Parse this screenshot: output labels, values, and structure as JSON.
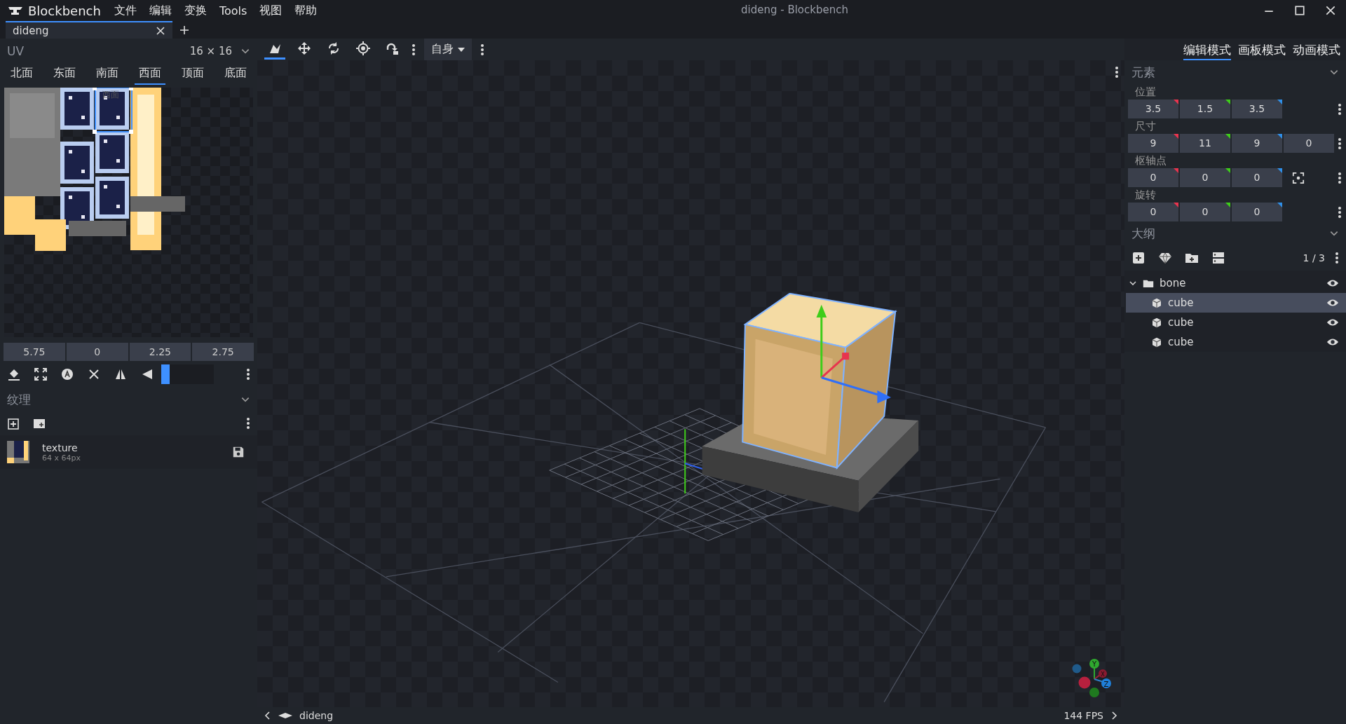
{
  "app": {
    "name": "Blockbench"
  },
  "menu": [
    "文件",
    "编辑",
    "变换",
    "Tools",
    "视图",
    "帮助"
  ],
  "window": {
    "title": "dideng - Blockbench"
  },
  "tabs": [
    {
      "label": "dideng",
      "selected": true
    }
  ],
  "uv_panel": {
    "title": "UV",
    "size": "16 × 16",
    "faces": [
      {
        "label": "北面",
        "selected": false
      },
      {
        "label": "东面",
        "selected": false
      },
      {
        "label": "南面",
        "selected": false
      },
      {
        "label": "西面",
        "selected": true
      },
      {
        "label": "顶面",
        "selected": false
      },
      {
        "label": "底面",
        "selected": false
      }
    ],
    "face_label": "西面",
    "fields": [
      "5.75",
      "0",
      "2.25",
      "2.75"
    ],
    "slider": {
      "level": 0.16
    }
  },
  "textures_panel": {
    "title": "纹理",
    "items": [
      {
        "name": "texture",
        "size": "64 x 64px"
      }
    ]
  },
  "toolbar": {
    "tools": [
      {
        "kind": "vertex",
        "selected": true
      },
      {
        "kind": "move",
        "selected": false
      },
      {
        "kind": "rotate",
        "selected": false
      },
      {
        "kind": "pivot",
        "selected": false
      },
      {
        "kind": "resize",
        "selected": false
      }
    ],
    "space": "自身"
  },
  "modes": [
    {
      "label": "编辑模式",
      "selected": true
    },
    {
      "label": "画板模式",
      "selected": false
    },
    {
      "label": "动画模式",
      "selected": false
    }
  ],
  "element_panel": {
    "title": "元素",
    "groups": [
      {
        "label": "位置",
        "kind": "vector",
        "values": [
          "3.5",
          "1.5",
          "3.5"
        ]
      },
      {
        "label": "尺寸",
        "kind": "vector",
        "values": [
          "9",
          "11",
          "9",
          "0"
        ]
      },
      {
        "label": "枢轴点",
        "kind": "pivot",
        "values": [
          "0",
          "0",
          "0"
        ]
      },
      {
        "label": "旋转",
        "kind": "vector",
        "values": [
          "0",
          "0",
          "0"
        ]
      }
    ]
  },
  "outliner": {
    "title": "大纲",
    "count": "1 / 3",
    "tree": [
      {
        "label": "bone",
        "kind": "group",
        "expanded": true,
        "selected": false,
        "children": [
          {
            "label": "cube",
            "kind": "cube",
            "selected": true
          },
          {
            "label": "cube",
            "kind": "cube",
            "selected": false
          },
          {
            "label": "cube",
            "kind": "cube",
            "selected": false
          }
        ]
      }
    ]
  },
  "viewport": {
    "gizmo_axes": [
      "Y",
      "X",
      "Z"
    ]
  },
  "status_bar": {
    "project": "dideng",
    "fps": "144 FPS"
  }
}
